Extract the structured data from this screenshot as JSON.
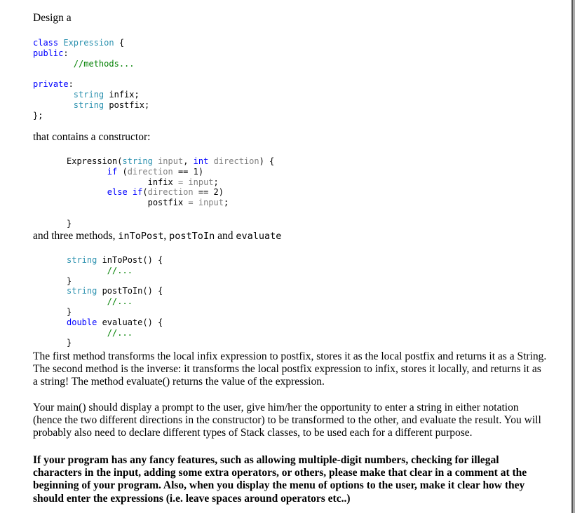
{
  "document": {
    "intro": "Design a",
    "class_code": {
      "line1_kw": "class",
      "line1_type": "Expression",
      "line1_rest": " {",
      "public_kw": "public",
      "colon": ":",
      "methods_comment": "//methods...",
      "private_kw": "private",
      "field1_type": "string",
      "field1_name": " infix;",
      "field2_type": "string",
      "field2_name": " postfix;",
      "close": "};"
    },
    "constructor_intro": "that contains a constructor:",
    "constructor_code": {
      "sig_name": "Expression(",
      "sig_type1": "string",
      "sig_param1": " input",
      "sig_comma": ", ",
      "sig_type2": "int",
      "sig_param2": " direction",
      "sig_end": ") {",
      "if_kw": "if",
      "if_open": " (",
      "if_param": "direction",
      "if_cond": " == 1)",
      "assign1_lhs": "infix",
      "assign1_op": " = ",
      "assign1_rhs": "input",
      "semi": ";",
      "elseif_kw": "else if",
      "elseif_open": "(",
      "elseif_param": "direction",
      "elseif_cond": " == 2)",
      "assign2_lhs": "postfix",
      "assign2_op": " = ",
      "assign2_rhs": "input",
      "close": "}"
    },
    "methods_intro": {
      "prefix": "and three methods, ",
      "m1": "inToPost",
      "sep1": ", ",
      "m2": "postToIn",
      "sep2": " and ",
      "m3": "evaluate"
    },
    "methods_code": {
      "m1_type": "string",
      "m1_sig": " inToPost() {",
      "m2_type": "string",
      "m2_sig": " postToIn() {",
      "m3_type": "double",
      "m3_sig": " evaluate() {",
      "body_comment": "//...",
      "close": "}"
    },
    "paragraph1": "The first method transforms the local infix expression to postfix, stores it as the local postfix and returns it as a String. The second method is the inverse: it transforms the local postfix expression to infix, stores it locally, and returns it as a string! The method evaluate() returns the value of the expression.",
    "paragraph2": "Your main() should display a prompt to the user, give him/her the opportunity to enter a string in either notation (hence the two different directions in the constructor) to be  transformed to the other, and evaluate the result. You will probably also need to declare different types of Stack classes, to be used each for a different purpose.",
    "paragraph3": "If your program has any fancy features, such as allowing multiple-digit numbers, checking for illegal characters in the input, adding some extra operators, or others, please make that clear in a comment at the beginning of your program. Also, when you display the menu of options to the user, make it clear how they should enter the expressions (i.e. leave spaces around operators etc..)"
  }
}
